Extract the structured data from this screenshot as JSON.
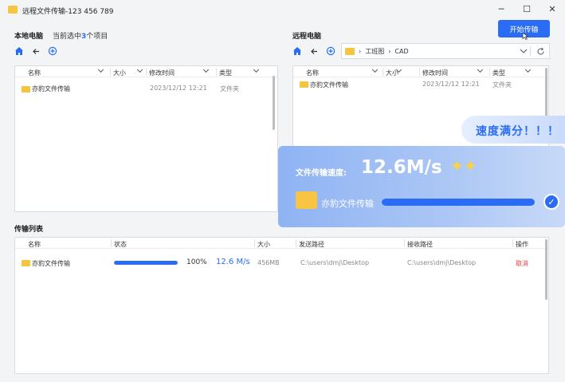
{
  "window": {
    "title": "远程文件传输-123 456 789"
  },
  "local": {
    "title": "本地电脑",
    "selection_prefix": "当前选中",
    "selection_count": "3",
    "selection_suffix": "个项目",
    "columns": [
      "名称",
      "大小",
      "修改时间",
      "类型"
    ],
    "rows": [
      {
        "name": "亦豹文件传输",
        "size": "",
        "modified": "2023/12/12 12:21",
        "type": "文件夹"
      }
    ]
  },
  "remote": {
    "title": "远程电脑",
    "path": [
      "工班图",
      "CAD"
    ],
    "columns": [
      "名称",
      "大小",
      "修改时间",
      "类型"
    ],
    "rows": [
      {
        "name": "亦豹文件传输",
        "size": "",
        "modified": "2023/12/12 12:21",
        "type": "文件夹"
      }
    ]
  },
  "toolbar": {
    "start_label": "开始传输"
  },
  "transfer": {
    "title": "传输列表",
    "columns": [
      "名称",
      "状态",
      "大小",
      "发送路径",
      "接收路径",
      "操作"
    ],
    "rows": [
      {
        "name": "亦豹文件传输",
        "progress": 100,
        "percent": "100%",
        "speed": "12.6 M/s",
        "size": "456MB",
        "from": "C:\\users\\dmj\\Desktop",
        "to": "C:\\users\\dmj\\Desktop",
        "action": "取消"
      }
    ]
  },
  "overlay": {
    "bubble": "速度满分！！！",
    "speed_label": "文件传输速度:",
    "speed_value": "12.6M/s",
    "file_name": "亦豹文件传输",
    "progress": 100
  },
  "colors": {
    "accent": "#2a6df4",
    "folder": "#f5c542",
    "danger": "#e64040"
  }
}
